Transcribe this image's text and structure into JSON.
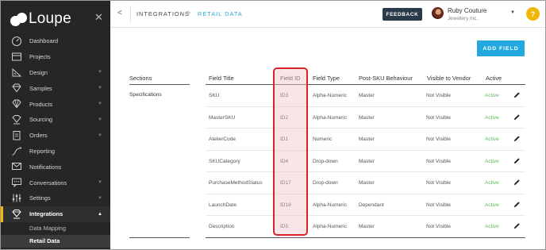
{
  "app": {
    "name": "Loupe"
  },
  "sidebar": {
    "items": [
      {
        "label": "Dashboard",
        "icon": "dashboard-icon",
        "chevron": false
      },
      {
        "label": "Projects",
        "icon": "projects-icon",
        "chevron": false
      },
      {
        "label": "Design",
        "icon": "design-icon",
        "chevron": true
      },
      {
        "label": "Samples",
        "icon": "samples-icon",
        "chevron": true
      },
      {
        "label": "Products",
        "icon": "products-icon",
        "chevron": true
      },
      {
        "label": "Sourcing",
        "icon": "sourcing-icon",
        "chevron": true
      },
      {
        "label": "Orders",
        "icon": "orders-icon",
        "chevron": true
      },
      {
        "label": "Reporting",
        "icon": "reporting-icon",
        "chevron": false
      },
      {
        "label": "Notifications",
        "icon": "notifications-icon",
        "chevron": false
      },
      {
        "label": "Conversations",
        "icon": "conversations-icon",
        "chevron": true
      },
      {
        "label": "Settings",
        "icon": "settings-icon",
        "chevron": true
      },
      {
        "label": "Integrations",
        "icon": "integrations-icon",
        "chevron": true,
        "active": true
      }
    ],
    "subitems": [
      {
        "label": "Data Mapping"
      },
      {
        "label": "Retail Data",
        "active": true
      }
    ]
  },
  "topbar": {
    "breadcrumb": [
      "INTEGRATIONS",
      "RETAIL DATA"
    ],
    "feedback_label": "FEEDBACK",
    "user_name": "Ruby Couture",
    "user_org": "Jewellery Inc.",
    "help_label": "?"
  },
  "main": {
    "add_field_label": "ADD FIELD",
    "sections_header": "Sections",
    "sections_value": "Specifications",
    "columns": [
      "Field Title",
      "Field ID",
      "Field Type",
      "Post-SKU Behaviour",
      "Visible to Vendor",
      "Active"
    ],
    "rows": [
      {
        "title": "SKU",
        "id": "ID3",
        "type": "Alpha-Numeric",
        "behaviour": "Master",
        "visible": "Not Visible",
        "active": "Active"
      },
      {
        "title": "MasterSKU",
        "id": "ID2",
        "type": "Alpha-Numeric",
        "behaviour": "Master",
        "visible": "Not Visible",
        "active": "Active"
      },
      {
        "title": "AtelierCode",
        "id": "ID1",
        "type": "Numeric",
        "behaviour": "Master",
        "visible": "Not Visible",
        "active": "Active"
      },
      {
        "title": "SKUCategory",
        "id": "ID4",
        "type": "Drop-down",
        "behaviour": "Master",
        "visible": "Not Visible",
        "active": "Active"
      },
      {
        "title": "PurchaseMethodStatus",
        "id": "ID17",
        "type": "Drop-down",
        "behaviour": "Master",
        "visible": "Not Visible",
        "active": "Active"
      },
      {
        "title": "LaunchDate",
        "id": "ID18",
        "type": "Alpha-Numeric",
        "behaviour": "Dependant",
        "visible": "Not Visible",
        "active": "Active"
      },
      {
        "title": "Description",
        "id": "ID5",
        "type": "Alpha-Numeric",
        "behaviour": "Master",
        "visible": "Not Visible",
        "active": "Active"
      }
    ]
  },
  "colors": {
    "sidebar_bg": "#262626",
    "accent_yellow": "#f2b705",
    "accent_blue": "#23a7df",
    "active_green": "#5cb85c",
    "highlight_red": "#d9252a"
  }
}
